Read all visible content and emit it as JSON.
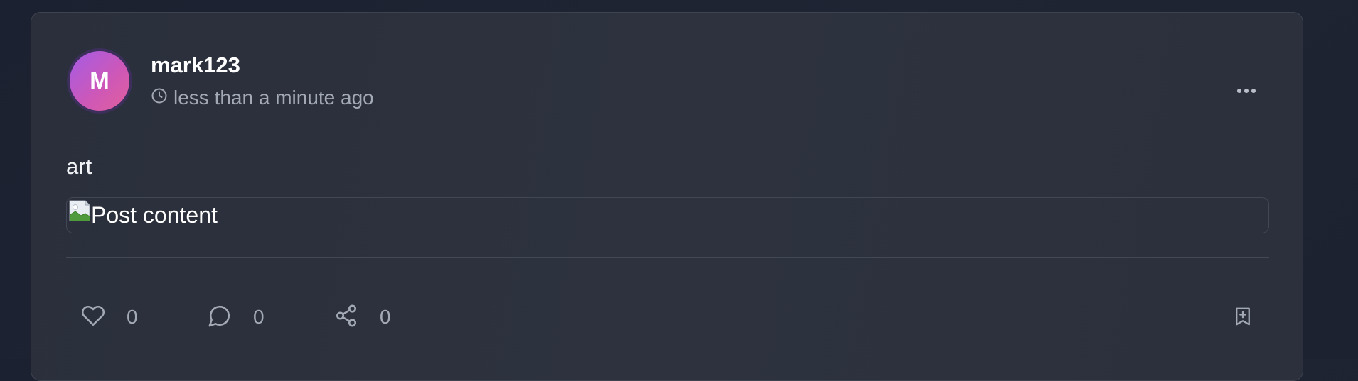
{
  "post": {
    "avatar_initial": "M",
    "username": "mark123",
    "timestamp": "less than a minute ago",
    "text": "art",
    "image_alt": "Post content"
  },
  "actions": {
    "likes": "0",
    "comments": "0",
    "shares": "0"
  },
  "icons": {
    "clock": "clock-icon",
    "more": "more-horizontal-icon",
    "like": "heart-icon",
    "comment": "message-circle-icon",
    "share": "share-icon",
    "bookmark": "bookmark-plus-icon"
  },
  "colors": {
    "background": "#1d2331",
    "card": "#2b303c",
    "avatar_gradient_start": "#a45be6",
    "avatar_gradient_end": "#e0609c",
    "muted_text": "#a4a9b6"
  }
}
